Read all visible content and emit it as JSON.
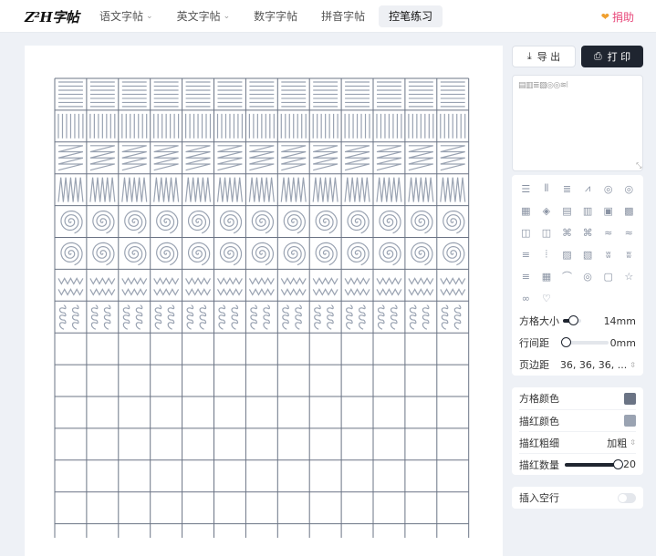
{
  "header": {
    "logo": "Z²H字帖",
    "nav": [
      {
        "label": "语文字帖",
        "dropdown": true,
        "active": false
      },
      {
        "label": "英文字帖",
        "dropdown": true,
        "active": false
      },
      {
        "label": "数字字帖",
        "dropdown": false,
        "active": false
      },
      {
        "label": "拼音字帖",
        "dropdown": false,
        "active": false
      },
      {
        "label": "控笔练习",
        "dropdown": false,
        "active": true
      }
    ],
    "donate": "捐助"
  },
  "actions": {
    "export": "导 出",
    "print": "打 印"
  },
  "pattern_input": {
    "value": "▤▥≣▨◎◎≋⦚",
    "resize_icon": "resize-handle-icon"
  },
  "patterns": [
    {
      "icon": "horizontal-lines-icon",
      "glyph": "☰"
    },
    {
      "icon": "vertical-lines-icon",
      "glyph": "⦀"
    },
    {
      "icon": "zigzag-horizontal-icon",
      "glyph": "≣"
    },
    {
      "icon": "zigzag-vertical-icon",
      "glyph": "⩘"
    },
    {
      "icon": "spiral-icon",
      "glyph": "◎"
    },
    {
      "icon": "spiral-reverse-icon",
      "glyph": "◎"
    },
    {
      "icon": "filled-square-icon",
      "glyph": "▦"
    },
    {
      "icon": "diamond-icon",
      "glyph": "◈"
    },
    {
      "icon": "corner-lines-icon",
      "glyph": "▤"
    },
    {
      "icon": "corner-lines-alt-icon",
      "glyph": "▥"
    },
    {
      "icon": "nested-square-icon",
      "glyph": "▣"
    },
    {
      "icon": "nested-square-alt-icon",
      "glyph": "▩"
    },
    {
      "icon": "square-spiral-icon",
      "glyph": "◫"
    },
    {
      "icon": "square-spiral-alt-icon",
      "glyph": "◫"
    },
    {
      "icon": "maze-icon",
      "glyph": "⌘"
    },
    {
      "icon": "maze-alt-icon",
      "glyph": "⌘"
    },
    {
      "icon": "waves-icon",
      "glyph": "≈"
    },
    {
      "icon": "waves-alt-icon",
      "glyph": "≈"
    },
    {
      "icon": "lines-short-icon",
      "glyph": "≡"
    },
    {
      "icon": "dashes-icon",
      "glyph": "⦙"
    },
    {
      "icon": "diagonal-lines-icon",
      "glyph": "▨"
    },
    {
      "icon": "diagonal-lines-alt-icon",
      "glyph": "▧"
    },
    {
      "icon": "grass-icon",
      "glyph": "ʬ"
    },
    {
      "icon": "grass-alt-icon",
      "glyph": "ʬ"
    },
    {
      "icon": "double-lines-icon",
      "glyph": "≡"
    },
    {
      "icon": "pattern-box-icon",
      "glyph": "▦"
    },
    {
      "icon": "arches-icon",
      "glyph": "⌒"
    },
    {
      "icon": "circles-icon",
      "glyph": "◎"
    },
    {
      "icon": "rounded-squares-icon",
      "glyph": "▢"
    },
    {
      "icon": "star-icon",
      "glyph": "☆"
    },
    {
      "icon": "loops-icon",
      "glyph": "∞"
    },
    {
      "icon": "heart-icon",
      "glyph": "♡"
    }
  ],
  "settings": {
    "grid_size": {
      "label": "方格大小",
      "value": "14mm",
      "fraction": 0.14
    },
    "line_spacing": {
      "label": "行间距",
      "value": "0mm",
      "fraction": 0.0
    },
    "margin": {
      "label": "页边距",
      "value": "36, 36, 36, ..."
    }
  },
  "colors": {
    "grid_color": {
      "label": "方格颜色",
      "color": "#6b7485"
    },
    "trace_color": {
      "label": "描红颜色",
      "color": "#9aa3b2"
    },
    "trace_weight": {
      "label": "描红粗细",
      "value": "加粗"
    },
    "trace_count": {
      "label": "描红数量",
      "value": "20",
      "fraction": 1.0
    }
  },
  "blank_row": {
    "label": "插入空行",
    "on": false
  },
  "worksheet": {
    "columns": 13,
    "rows": 15,
    "pattern_rows": [
      "horizontal-lines",
      "vertical-lines",
      "zigzag-horizontal",
      "zigzag-vertical",
      "spiral",
      "spiral",
      "waves",
      "loops"
    ]
  }
}
